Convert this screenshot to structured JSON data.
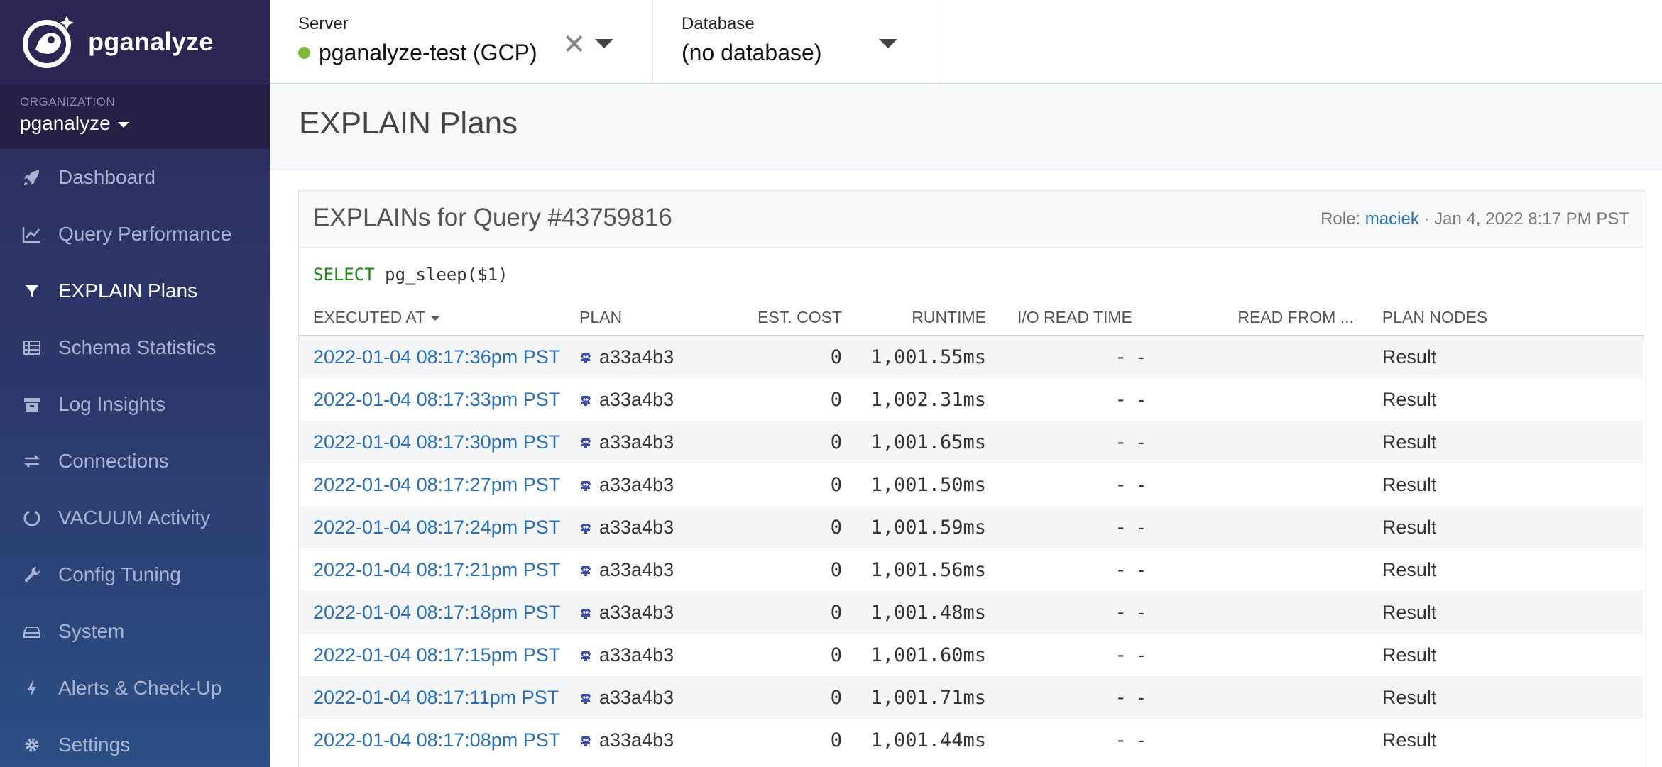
{
  "sidebar": {
    "brand": "pganalyze",
    "org_label": "ORGANIZATION",
    "org_name": "pganalyze",
    "items": [
      {
        "label": "Dashboard",
        "icon": "rocket-icon"
      },
      {
        "label": "Query Performance",
        "icon": "line-chart-icon"
      },
      {
        "label": "EXPLAIN Plans",
        "icon": "filter-icon"
      },
      {
        "label": "Schema Statistics",
        "icon": "table-icon"
      },
      {
        "label": "Log Insights",
        "icon": "archive-icon"
      },
      {
        "label": "Connections",
        "icon": "exchange-icon"
      },
      {
        "label": "VACUUM Activity",
        "icon": "circle-notch-icon"
      },
      {
        "label": "Config Tuning",
        "icon": "wrench-icon"
      },
      {
        "label": "System",
        "icon": "hdd-icon"
      },
      {
        "label": "Alerts & Check-Up",
        "icon": "bolt-icon"
      },
      {
        "label": "Settings",
        "icon": "gear-icon"
      }
    ],
    "active_item": "EXPLAIN Plans"
  },
  "topbar": {
    "server_label": "Server",
    "server_value": "pganalyze-test (GCP)",
    "server_status_color": "#7fb83c",
    "clear_glyph": "✕",
    "database_label": "Database",
    "database_value": "(no database)"
  },
  "page": {
    "title": "EXPLAIN Plans"
  },
  "panel": {
    "title": "EXPLAINs for Query #43759816",
    "role_prefix": "Role:",
    "role_name": "maciek",
    "separator": "·",
    "timestamp": "Jan 4, 2022 8:17 PM PST",
    "sql_keyword": "SELECT",
    "sql_rest": " pg_sleep($1)"
  },
  "table": {
    "columns": {
      "executed_at": "EXECUTED AT",
      "plan": "PLAN",
      "est_cost": "EST. COST",
      "runtime": "RUNTIME",
      "io_read_time": "I/O READ TIME",
      "read_from": "READ FROM ...",
      "plan_nodes": "PLAN NODES"
    },
    "rows": [
      {
        "executed_at": "2022-01-04 08:17:36pm PST",
        "plan": "a33a4b3",
        "est_cost": "0",
        "runtime": "1,001.55ms",
        "io_read_time": "-",
        "read_from": "-",
        "plan_nodes": "Result"
      },
      {
        "executed_at": "2022-01-04 08:17:33pm PST",
        "plan": "a33a4b3",
        "est_cost": "0",
        "runtime": "1,002.31ms",
        "io_read_time": "-",
        "read_from": "-",
        "plan_nodes": "Result"
      },
      {
        "executed_at": "2022-01-04 08:17:30pm PST",
        "plan": "a33a4b3",
        "est_cost": "0",
        "runtime": "1,001.65ms",
        "io_read_time": "-",
        "read_from": "-",
        "plan_nodes": "Result"
      },
      {
        "executed_at": "2022-01-04 08:17:27pm PST",
        "plan": "a33a4b3",
        "est_cost": "0",
        "runtime": "1,001.50ms",
        "io_read_time": "-",
        "read_from": "-",
        "plan_nodes": "Result"
      },
      {
        "executed_at": "2022-01-04 08:17:24pm PST",
        "plan": "a33a4b3",
        "est_cost": "0",
        "runtime": "1,001.59ms",
        "io_read_time": "-",
        "read_from": "-",
        "plan_nodes": "Result"
      },
      {
        "executed_at": "2022-01-04 08:17:21pm PST",
        "plan": "a33a4b3",
        "est_cost": "0",
        "runtime": "1,001.56ms",
        "io_read_time": "-",
        "read_from": "-",
        "plan_nodes": "Result"
      },
      {
        "executed_at": "2022-01-04 08:17:18pm PST",
        "plan": "a33a4b3",
        "est_cost": "0",
        "runtime": "1,001.48ms",
        "io_read_time": "-",
        "read_from": "-",
        "plan_nodes": "Result"
      },
      {
        "executed_at": "2022-01-04 08:17:15pm PST",
        "plan": "a33a4b3",
        "est_cost": "0",
        "runtime": "1,001.60ms",
        "io_read_time": "-",
        "read_from": "-",
        "plan_nodes": "Result"
      },
      {
        "executed_at": "2022-01-04 08:17:11pm PST",
        "plan": "a33a4b3",
        "est_cost": "0",
        "runtime": "1,001.71ms",
        "io_read_time": "-",
        "read_from": "-",
        "plan_nodes": "Result"
      },
      {
        "executed_at": "2022-01-04 08:17:08pm PST",
        "plan": "a33a4b3",
        "est_cost": "0",
        "runtime": "1,001.44ms",
        "io_read_time": "-",
        "read_from": "-",
        "plan_nodes": "Result"
      }
    ]
  },
  "colors": {
    "link": "#2a6fb6",
    "sidebar_top": "#2f2a5a",
    "sidebar_bottom": "#2b4f86"
  }
}
